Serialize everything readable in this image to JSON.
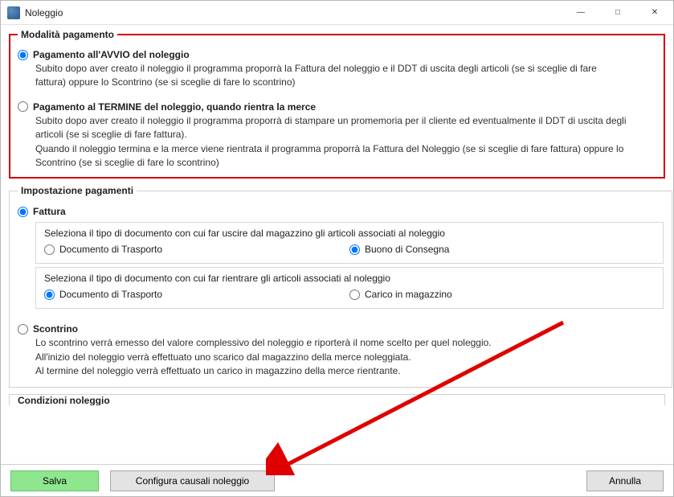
{
  "window": {
    "title": "Noleggio"
  },
  "section_payment_mode": {
    "legend": "Modalità pagamento",
    "option_start": {
      "label": "Pagamento all'AVVIO del noleggio",
      "desc": "Subito dopo aver creato il noleggio il programma proporrà la Fattura  del noleggio e il DDT di uscita degli articoli (se si sceglie di fare fattura) oppure lo Scontrino (se si sceglie di fare lo scontrino)",
      "checked": true
    },
    "option_end": {
      "label": "Pagamento al TERMINE del noleggio, quando rientra la merce",
      "desc": "Subito dopo aver creato il noleggio il programma proporrà di stampare un promemoria per il cliente ed eventualmente il DDT di uscita degli articoli (se si sceglie di fare fattura).\nQuando il noleggio termina e la merce viene rientrata il programma proporrà la Fattura del Noleggio (se si sceglie di fare fattura) oppure lo Scontrino (se si sceglie di fare lo scontrino)",
      "checked": false
    }
  },
  "section_payment_settings": {
    "legend": "Impostazione pagamenti",
    "fattura": {
      "label": "Fattura",
      "checked": true,
      "uscita_prompt": "Seleziona il tipo di documento con cui far uscire dal magazzino gli articoli associati al noleggio",
      "uscita_ddt": {
        "label": "Documento di Trasporto",
        "checked": false
      },
      "uscita_buono": {
        "label": "Buono di Consegna",
        "checked": true
      },
      "rientro_prompt": "Seleziona il tipo di documento con cui far rientrare gli articoli associati al noleggio",
      "rientro_ddt": {
        "label": "Documento di Trasporto",
        "checked": true
      },
      "rientro_carico": {
        "label": "Carico in magazzino",
        "checked": false
      }
    },
    "scontrino": {
      "label": "Scontrino",
      "checked": false,
      "desc": "Lo scontrino verrà emesso del valore complessivo del noleggio e riporterà il nome scelto per quel noleggio.\nAll'inizio del noleggio verrà effettuato uno scarico dal magazzino della merce noleggiata.\nAl termine del noleggio verrà effettuato un carico in magazzino della merce rientrante."
    }
  },
  "section_conditions": {
    "legend": "Condizioni noleggio"
  },
  "footer": {
    "save": "Salva",
    "config": "Configura causali noleggio",
    "cancel": "Annulla"
  }
}
